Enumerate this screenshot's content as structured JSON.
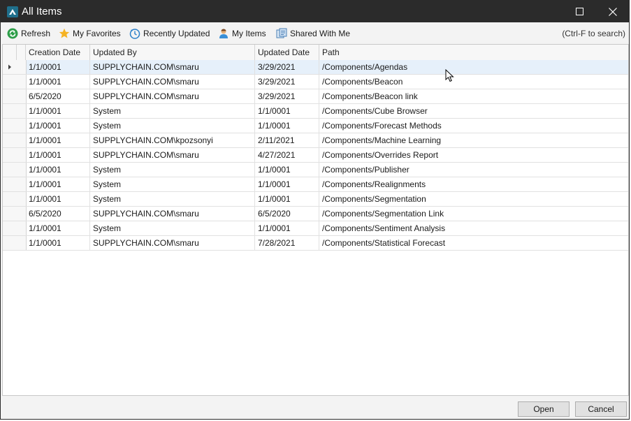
{
  "window": {
    "title": "All Items",
    "icons": {
      "app": "app-logo-icon",
      "maximize": "maximize-icon",
      "close": "close-icon"
    }
  },
  "toolbar": {
    "items": [
      {
        "label": "Refresh",
        "icon": "refresh-icon"
      },
      {
        "label": "My Favorites",
        "icon": "star-icon"
      },
      {
        "label": "Recently Updated",
        "icon": "clock-icon"
      },
      {
        "label": "My Items",
        "icon": "user-icon"
      },
      {
        "label": "Shared With Me",
        "icon": "shared-icon"
      }
    ],
    "search_hint": "(Ctrl-F to search)"
  },
  "grid": {
    "columns": [
      "Creation Date",
      "Updated By",
      "Updated Date",
      "Path"
    ],
    "rows": [
      [
        "1/1/0001",
        "SUPPLYCHAIN.COM\\smaru",
        "3/29/2021",
        "/Components/Agendas"
      ],
      [
        "1/1/0001",
        "SUPPLYCHAIN.COM\\smaru",
        "3/29/2021",
        "/Components/Beacon"
      ],
      [
        "6/5/2020",
        "SUPPLYCHAIN.COM\\smaru",
        "3/29/2021",
        "/Components/Beacon link"
      ],
      [
        "1/1/0001",
        "System",
        "1/1/0001",
        "/Components/Cube Browser"
      ],
      [
        "1/1/0001",
        "System",
        "1/1/0001",
        "/Components/Forecast Methods"
      ],
      [
        "1/1/0001",
        "SUPPLYCHAIN.COM\\kpozsonyi",
        "2/11/2021",
        "/Components/Machine Learning"
      ],
      [
        "1/1/0001",
        "SUPPLYCHAIN.COM\\smaru",
        "4/27/2021",
        "/Components/Overrides Report"
      ],
      [
        "1/1/0001",
        "System",
        "1/1/0001",
        "/Components/Publisher"
      ],
      [
        "1/1/0001",
        "System",
        "1/1/0001",
        "/Components/Realignments"
      ],
      [
        "1/1/0001",
        "System",
        "1/1/0001",
        "/Components/Segmentation"
      ],
      [
        "6/5/2020",
        "SUPPLYCHAIN.COM\\smaru",
        "6/5/2020",
        "/Components/Segmentation Link"
      ],
      [
        "1/1/0001",
        "System",
        "1/1/0001",
        "/Components/Sentiment Analysis"
      ],
      [
        "1/1/0001",
        "SUPPLYCHAIN.COM\\smaru",
        "7/28/2021",
        "/Components/Statistical Forecast"
      ]
    ],
    "selected_row": 0
  },
  "footer": {
    "open_label": "Open",
    "cancel_label": "Cancel"
  },
  "colors": {
    "titlebar": "#2b2b2b",
    "accent": "#1e8a8a",
    "selection": "#e6f0fa"
  }
}
